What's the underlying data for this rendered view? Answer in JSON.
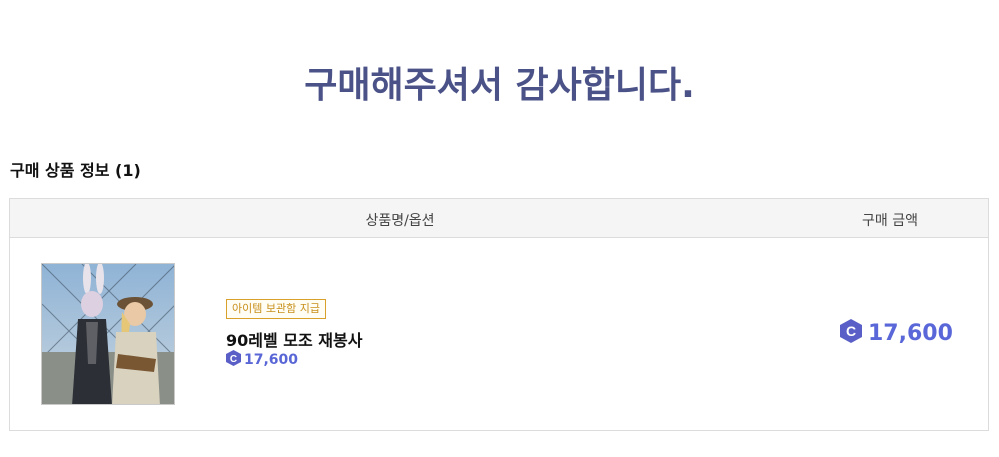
{
  "page": {
    "title": "구매해주셔서 감사합니다."
  },
  "order_section": {
    "title": "구매 상품 정보 (1)",
    "headers": {
      "product": "상품명/옵션",
      "amount": "구매 금액"
    },
    "items": [
      {
        "badge": "아이템 보관함 지급",
        "name": "90레벨 모조 재봉사",
        "unit_price": "17,600",
        "total_price": "17,600",
        "image": "character-thumbnail",
        "currency_icon": "crysta-coin-icon"
      }
    ]
  },
  "colors": {
    "title": "#4a5287",
    "price": "#5a67d8",
    "badge": "#d9a12a",
    "coin": "#5a5fc7"
  }
}
